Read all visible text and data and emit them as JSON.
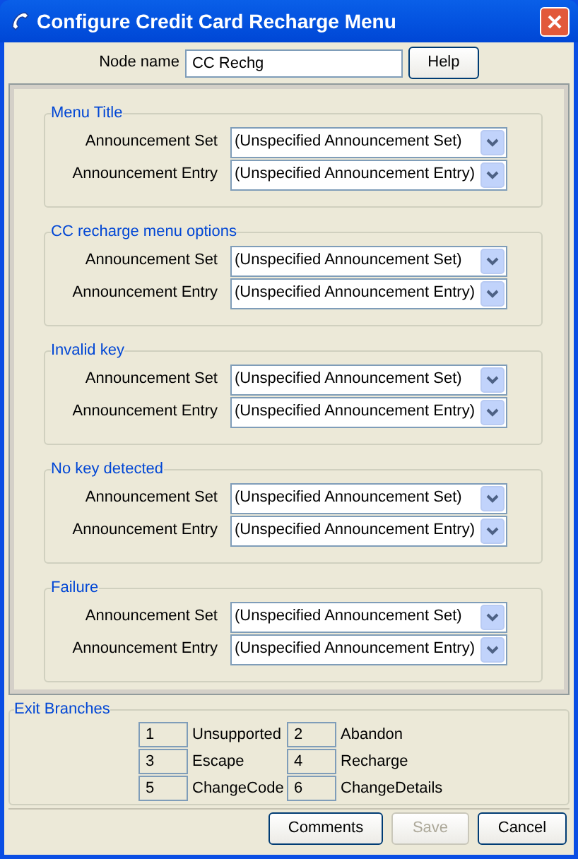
{
  "window": {
    "title": "Configure Credit Card Recharge Menu"
  },
  "node_name": {
    "label": "Node name",
    "value": "CC Rechg",
    "help": "Help"
  },
  "groups": [
    {
      "title": "Menu Title",
      "fields": [
        {
          "label": "Announcement Set",
          "value": "(Unspecified Announcement Set)"
        },
        {
          "label": "Announcement Entry",
          "value": "(Unspecified Announcement Entry)"
        }
      ]
    },
    {
      "title": "CC recharge menu options",
      "fields": [
        {
          "label": "Announcement Set",
          "value": "(Unspecified Announcement Set)"
        },
        {
          "label": "Announcement Entry",
          "value": "(Unspecified Announcement Entry)"
        }
      ]
    },
    {
      "title": "Invalid key",
      "fields": [
        {
          "label": "Announcement Set",
          "value": "(Unspecified Announcement Set)"
        },
        {
          "label": "Announcement Entry",
          "value": "(Unspecified Announcement Entry)"
        }
      ]
    },
    {
      "title": "No key detected",
      "fields": [
        {
          "label": "Announcement Set",
          "value": "(Unspecified Announcement Set)"
        },
        {
          "label": "Announcement Entry",
          "value": "(Unspecified Announcement Entry)"
        }
      ]
    },
    {
      "title": "Failure",
      "fields": [
        {
          "label": "Announcement Set",
          "value": "(Unspecified Announcement Set)"
        },
        {
          "label": "Announcement Entry",
          "value": "(Unspecified Announcement Entry)"
        }
      ]
    }
  ],
  "exit_branches": {
    "title": "Exit Branches",
    "items": [
      {
        "number": "1",
        "label": "Unsupported"
      },
      {
        "number": "2",
        "label": "Abandon"
      },
      {
        "number": "3",
        "label": "Escape"
      },
      {
        "number": "4",
        "label": "Recharge"
      },
      {
        "number": "5",
        "label": "ChangeCode"
      },
      {
        "number": "6",
        "label": "ChangeDetails"
      }
    ]
  },
  "buttons": [
    {
      "label": "Comments",
      "disabled": false
    },
    {
      "label": "Save",
      "disabled": true
    },
    {
      "label": "Cancel",
      "disabled": false
    }
  ]
}
